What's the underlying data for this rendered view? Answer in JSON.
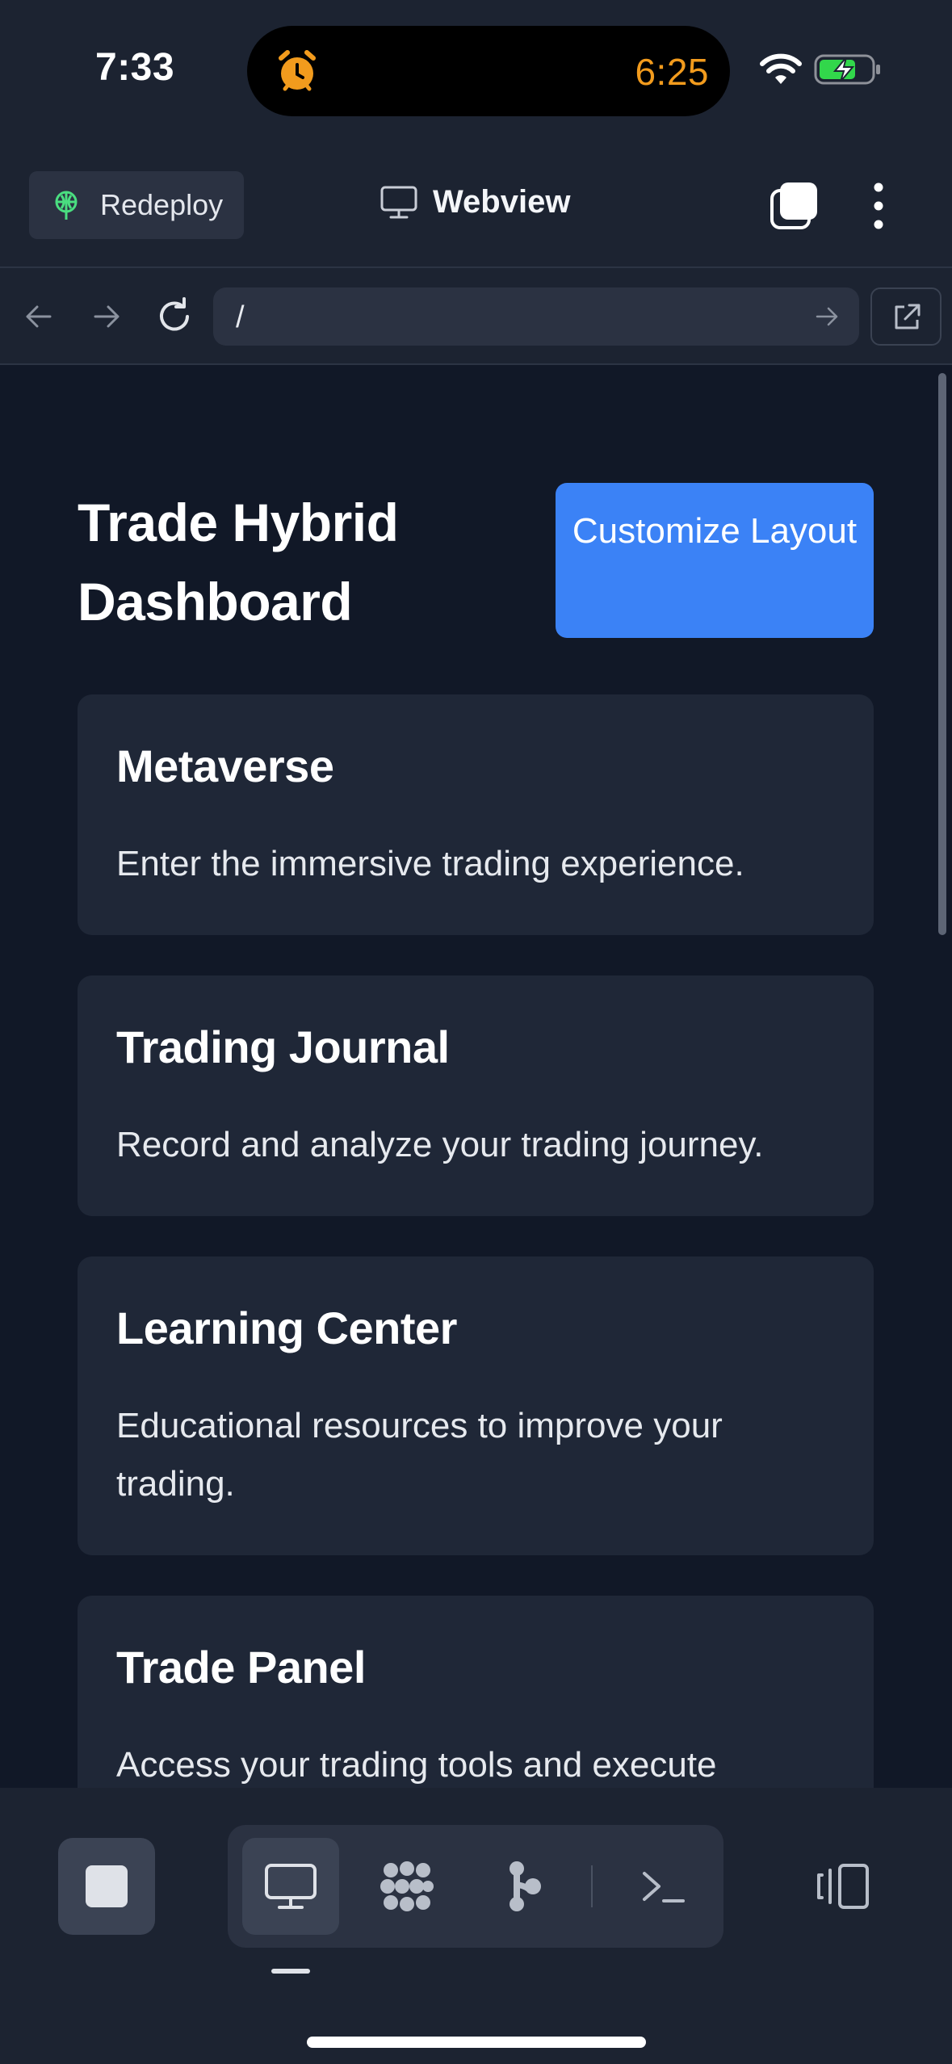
{
  "status_bar": {
    "time": "7:33",
    "timer": "6:25",
    "timer_color": "#f29b1d",
    "alarm_icon": "alarm-clock-icon",
    "battery_state": "charging",
    "battery_color": "#32d74b"
  },
  "header": {
    "redeploy_label": "Redeploy",
    "title": "Webview",
    "title_icon": "monitor-icon",
    "tabs_icon": "tabs-icon",
    "menu_icon": "more-vertical-icon"
  },
  "browser": {
    "url": "/",
    "back_icon": "arrow-left-icon",
    "forward_icon": "arrow-right-icon",
    "reload_icon": "reload-icon",
    "open_external_icon": "external-link-icon"
  },
  "dashboard": {
    "title": "Trade Hybrid Dashboard",
    "customize_button": "Customize Layout",
    "accent_color": "#3b82f6",
    "cards": [
      {
        "title": "Metaverse",
        "description": "Enter the immersive trading experience."
      },
      {
        "title": "Trading Journal",
        "description": "Record and analyze your trading journey."
      },
      {
        "title": "Learning Center",
        "description": "Educational resources to improve your trading."
      },
      {
        "title": "Trade Panel",
        "description": "Access your trading tools and execute"
      }
    ]
  },
  "toolbar": {
    "stop_icon": "stop-icon",
    "tools": [
      {
        "name": "webview",
        "icon": "monitor-icon",
        "active": true
      },
      {
        "name": "agent",
        "icon": "agent-icon",
        "active": false
      },
      {
        "name": "git",
        "icon": "git-icon",
        "active": false
      },
      {
        "name": "shell",
        "icon": "terminal-icon",
        "active": false
      }
    ],
    "panel_icon": "panel-toggle-icon"
  }
}
